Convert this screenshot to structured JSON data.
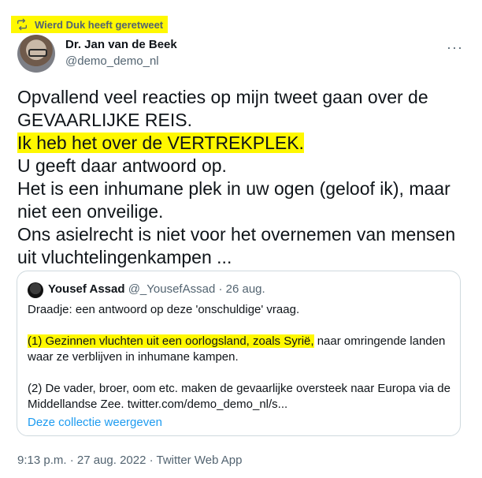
{
  "retweet": {
    "label": "Wierd Duk heeft geretweet"
  },
  "author": {
    "name": "Dr. Jan van de Beek",
    "handle": "@demo_demo_nl"
  },
  "more_label": "···",
  "tweet": {
    "lines": [
      "Opvallend veel reacties op mijn tweet gaan over de",
      "GEVAARLIJKE REIS.",
      "Ik heb het over de VERTREKPLEK.",
      "U geeft daar antwoord op.",
      "Het is een inhumane plek in uw ogen (geloof ik), maar",
      "niet een onveilige.",
      "Ons asielrecht is niet voor het overnemen van mensen",
      "uit vluchtelingenkampen ..."
    ]
  },
  "quote": {
    "name": "Yousef Assad",
    "handle": "@_YousefAssad",
    "date": "26 aug.",
    "intro": "Draadje: een antwoord op deze 'onschuldige' vraag.",
    "p1_highlight": "(1) Gezinnen vluchten uit een oorlogsland, zoals Syrië,",
    "p1_rest": " naar omringende landen",
    "p1_line2": "waar ze verblijven in inhumane kampen.",
    "p2_line1": "(2) De vader, broer, oom etc. maken de gevaarlijke oversteek naar Europa via de",
    "p2_line2": "Middellandse Zee. twitter.com/demo_demo_nl/s...",
    "show_collection": "Deze collectie weergeven"
  },
  "footer": {
    "meta": "9:13 p.m. · 27 aug. 2022 · Twitter Web App"
  },
  "icons": {
    "retweet": "retweet-icon",
    "more": "more-icon"
  }
}
